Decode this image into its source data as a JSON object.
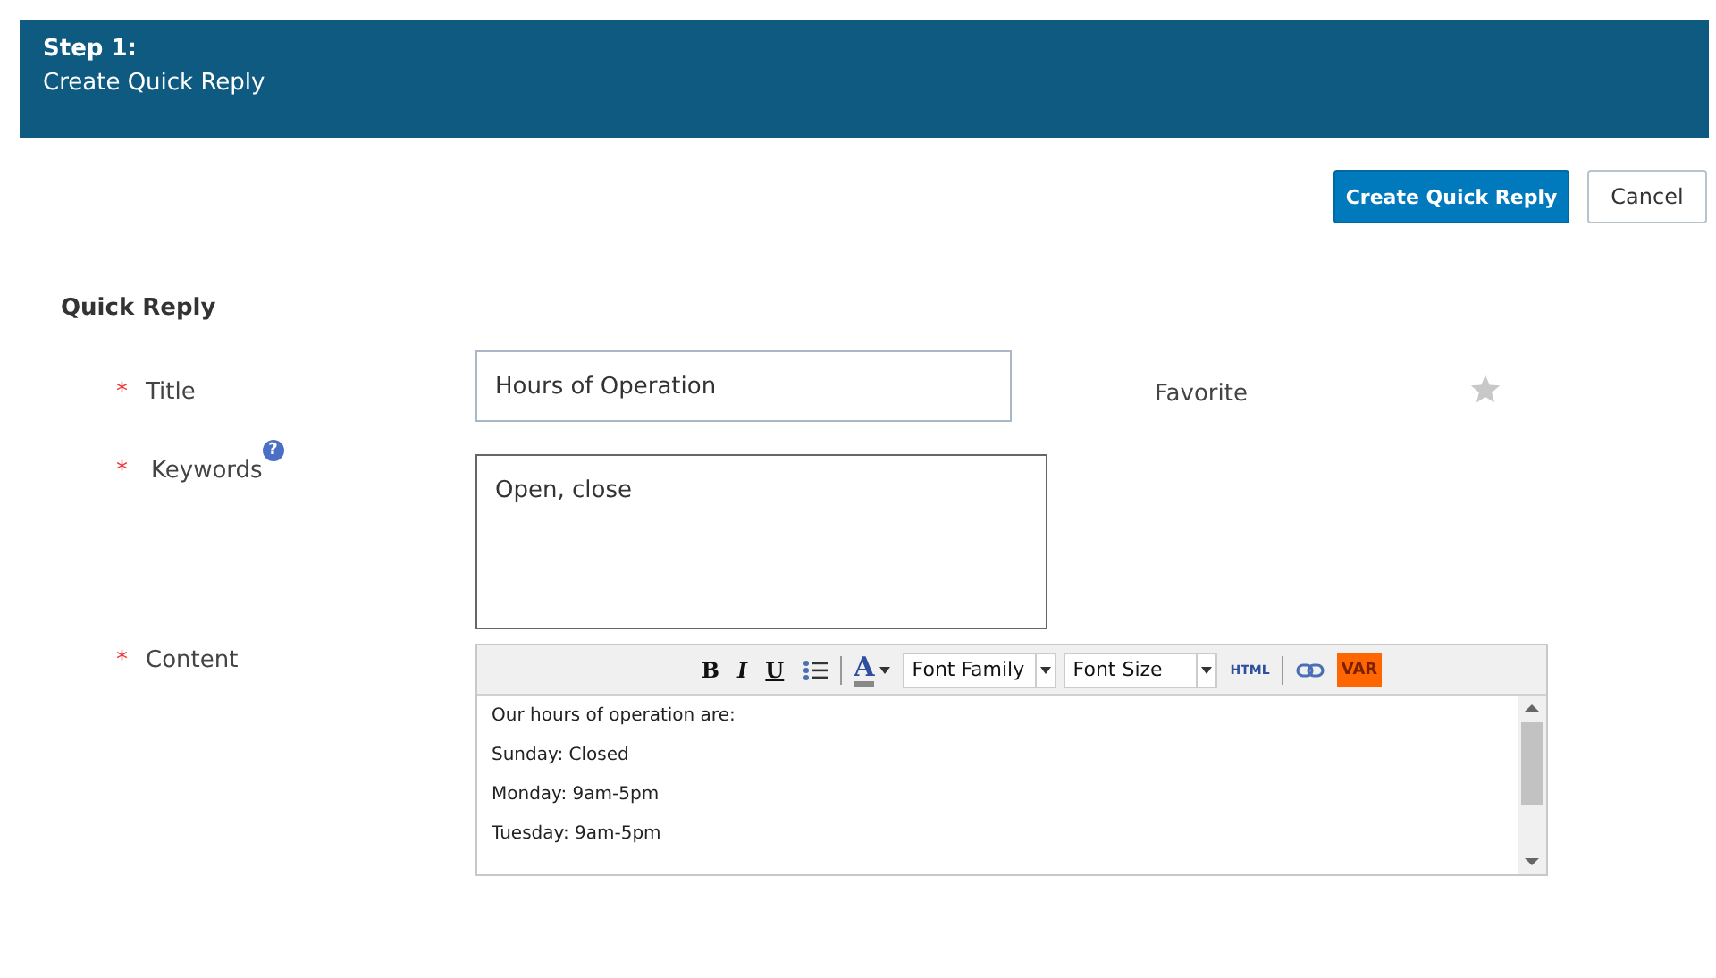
{
  "header": {
    "step": "Step 1:",
    "title": "Create Quick Reply"
  },
  "buttons": [
    {
      "label": "Create Quick Reply",
      "kind": "primary"
    },
    {
      "label": "Cancel",
      "kind": "secondary"
    }
  ],
  "section_title": "Quick Reply",
  "fields": [
    {
      "required_mark": "*",
      "label": "Title",
      "kind": "text",
      "value": "Hours of Operation"
    },
    {
      "required_mark": "*",
      "label": "Keywords",
      "kind": "textarea",
      "value": "Open, close",
      "help": "?"
    },
    {
      "required_mark": "*",
      "label": "Content",
      "kind": "editor"
    }
  ],
  "favorite": {
    "label": "Favorite",
    "checked": false
  },
  "editor": {
    "toolbar": [
      {
        "kind": "bold",
        "label": "B"
      },
      {
        "kind": "italic",
        "label": "I"
      },
      {
        "kind": "underline",
        "label": "U"
      },
      {
        "kind": "list"
      },
      {
        "kind": "separator"
      },
      {
        "kind": "color",
        "label": "A"
      },
      {
        "kind": "select",
        "label": "Font Family"
      },
      {
        "kind": "select",
        "label": "Font Size"
      },
      {
        "kind": "html",
        "label": "HTML"
      },
      {
        "kind": "separator"
      },
      {
        "kind": "link"
      },
      {
        "kind": "var",
        "label": "VAR"
      }
    ],
    "lines": [
      "Our hours of operation are:",
      "Sunday: Closed",
      "Monday: 9am-5pm",
      "Tuesday: 9am-5pm"
    ]
  }
}
